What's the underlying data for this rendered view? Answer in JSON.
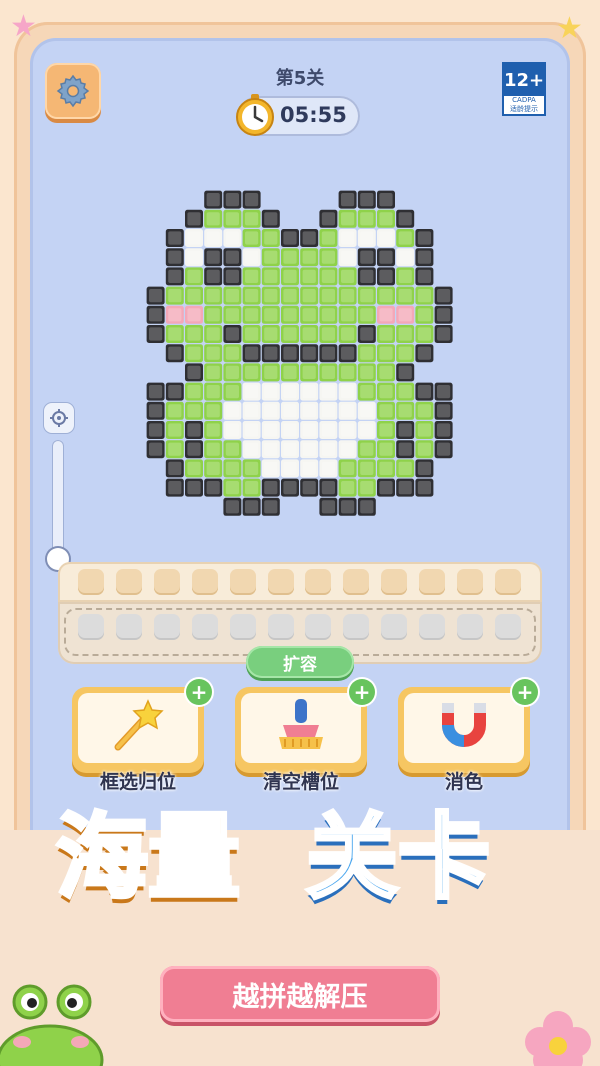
{
  "game": {
    "level_label": "第5关",
    "timer": "05:55",
    "age_rating": "12+",
    "age_org": "CADPA",
    "age_tip": "适龄提示"
  },
  "pixel_art": {
    "subject": "frog",
    "palette": {
      "K": "#2f2f33",
      "G": "#8fd24a",
      "W": "#f6f6f2",
      "P": "#f4a8b8"
    },
    "rows": [
      "...KKK....KKK...",
      "..KGGGK..KGGGK..",
      ".KWWWGGKKGWWWGK.",
      ".KWKKWGGGGWKKWK.",
      ".KGKKGGGGGGKKGK.",
      "KGGGGGGGGGGGGGGK",
      "KPPGGGGGGGGGPPGK",
      "KGGGKGGGGGGKGGGK",
      ".KGGGKKKKKKGGGK.",
      "..KGGGGGGGGGGK..",
      "KKGGGWWWWWWGGGKK",
      "KGGGWWWWWWWWGGGK",
      "KGKGWWWWWWWWGKGK",
      "KGKGGWWWWWWGGKGK",
      ".KGGGGWWWWGGGGK.",
      ".KKKGGKKKKGGKKK.",
      "....KKK..KKK...."
    ]
  },
  "slots": {
    "row1_count": 12,
    "row2_count": 12
  },
  "expand_label": "扩容",
  "powerups": [
    {
      "label": "框选归位",
      "icon": "magic-wand-icon"
    },
    {
      "label": "清空槽位",
      "icon": "brush-icon"
    },
    {
      "label": "消色",
      "icon": "magnet-icon"
    }
  ],
  "banner": {
    "title_part1": "海量",
    "title_part2": "关卡",
    "subtitle": "越拼越解压"
  },
  "colors": {
    "board": "#c4d3f4",
    "title_orange": "#f7b23a",
    "title_blue": "#4aa6ee",
    "expand_green": "#79cf7e",
    "subtitle_pink": "#f07e93"
  }
}
